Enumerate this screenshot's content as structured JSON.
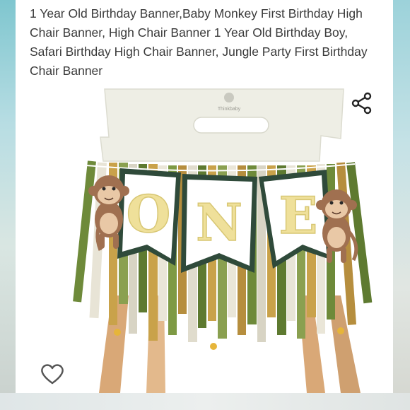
{
  "product": {
    "title": "1 Year Old Birthday Banner,Baby Monkey First Birthday High Chair Banner, High Chair Banner 1 Year Old Birthday Boy, Safari Birthday High Chair Banner, Jungle Party First Birthday Chair Banner",
    "image": {
      "brand_logo_text": "Thinkbaby",
      "pennant_letters": [
        "O",
        "N",
        "E"
      ]
    }
  },
  "actions": {
    "share_icon": "share-icon",
    "like_icon": "heart-outline-icon"
  },
  "colors": {
    "title_text": "#3a3a3a",
    "pennant_border": "#2f4a3a",
    "letter_fill": "#efe09a",
    "ribbon_green": "#6e8a3a",
    "ribbon_gold": "#c9a24a",
    "chair_wood": "#d9a877"
  }
}
